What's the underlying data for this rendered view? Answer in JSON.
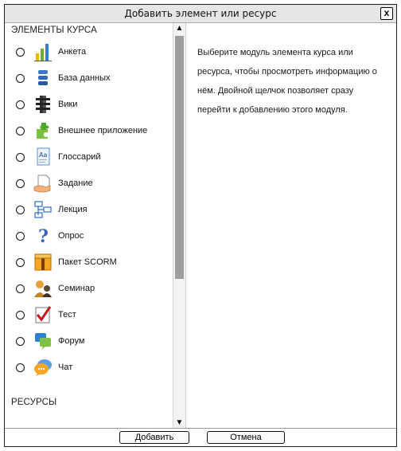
{
  "dialog": {
    "title": "Добавить элемент или ресурс",
    "close_label": "x"
  },
  "sections": {
    "activities": "ЭЛЕМЕНТЫ КУРСА",
    "resources": "РЕСУРСЫ"
  },
  "modules": [
    {
      "label": "Анкета",
      "icon": "survey-icon"
    },
    {
      "label": "База данных",
      "icon": "database-icon"
    },
    {
      "label": "Вики",
      "icon": "wiki-icon"
    },
    {
      "label": "Внешнее приложение",
      "icon": "external-tool-icon"
    },
    {
      "label": "Глоссарий",
      "icon": "glossary-icon"
    },
    {
      "label": "Задание",
      "icon": "assignment-icon"
    },
    {
      "label": "Лекция",
      "icon": "lesson-icon"
    },
    {
      "label": "Опрос",
      "icon": "choice-icon"
    },
    {
      "label": "Пакет SCORM",
      "icon": "scorm-icon"
    },
    {
      "label": "Семинар",
      "icon": "workshop-icon"
    },
    {
      "label": "Тест",
      "icon": "quiz-icon"
    },
    {
      "label": "Форум",
      "icon": "forum-icon"
    },
    {
      "label": "Чат",
      "icon": "chat-icon"
    }
  ],
  "info": {
    "text": "Выберите модуль элемента курса или ресурса, чтобы просмотреть информацию о нём. Двойной щелчок позволяет сразу перейти к добавлению этого модуля."
  },
  "buttons": {
    "add": "Добавить",
    "cancel": "Отмена"
  }
}
